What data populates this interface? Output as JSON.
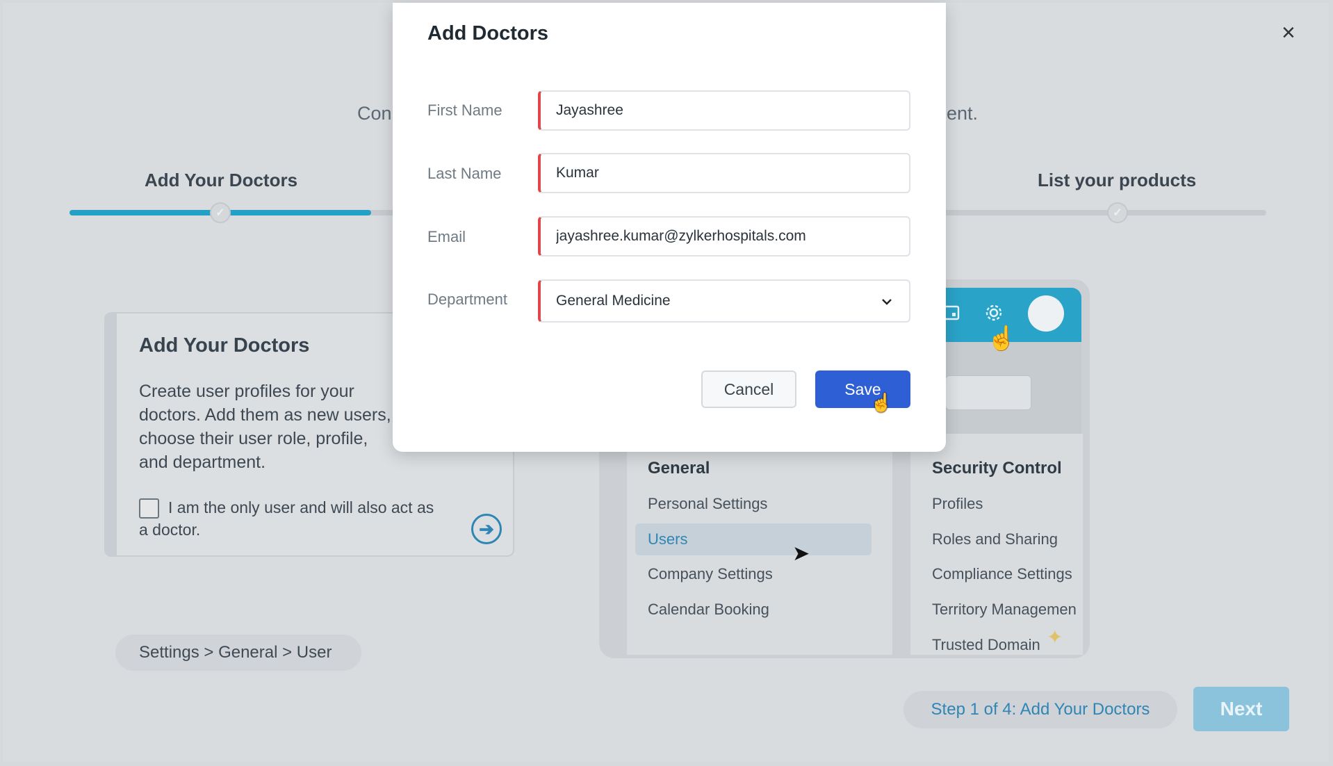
{
  "window": {
    "close_symbol": "×"
  },
  "background": {
    "subtitle_left": "Con",
    "subtitle_right": "ent.",
    "steps": [
      {
        "label": "Add Your Doctors",
        "check": "✓"
      },
      {
        "label": "List your products",
        "check": "✓"
      }
    ],
    "card": {
      "title": "Add Your Doctors",
      "description": "Create user profiles for your doctors. Add them as new users, choose their user role, profile, and department.",
      "checkbox_label": "I am the only user and will also act as a doctor.",
      "arrow": "➔"
    },
    "breadcrumb": "Settings > General > User",
    "preview": {
      "icons": {
        "calendar": "calendar-icon",
        "settings": "gear-icon",
        "avatar": "avatar-icon"
      },
      "general": {
        "heading": "General",
        "items": [
          "Personal Settings",
          "Users",
          "Company Settings",
          "Calendar Booking"
        ]
      },
      "security": {
        "heading": "Security Control",
        "items": [
          "Profiles",
          "Roles and Sharing",
          "Compliance Settings",
          "Territory Managemen",
          "Trusted Domain"
        ]
      }
    },
    "footer": {
      "step_indicator": "Step 1 of 4: Add Your Doctors",
      "next_label": "Next"
    }
  },
  "modal": {
    "title": "Add Doctors",
    "fields": {
      "first_name": {
        "label": "First Name",
        "value": "Jayashree"
      },
      "last_name": {
        "label": "Last Name",
        "value": "Kumar"
      },
      "email": {
        "label": "Email",
        "value": "jayashree.kumar@zylkerhospitals.com"
      },
      "department": {
        "label": "Department",
        "value": "General Medicine"
      }
    },
    "cancel_label": "Cancel",
    "save_label": "Save"
  },
  "colors": {
    "accent": "#22a0c6",
    "save_button": "#2f5fd4",
    "required_marker": "#e0474c",
    "next_button_disabled": "#8cc3dc"
  }
}
